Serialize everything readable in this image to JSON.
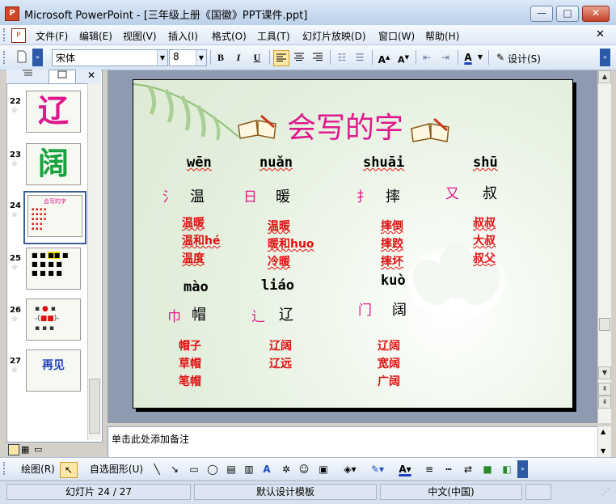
{
  "window": {
    "title": "Microsoft PowerPoint - [三年级上册《国徽》PPT课件.ppt]",
    "minimize_label": "—",
    "maximize_label": "□",
    "close_label": "✕",
    "doc_close_label": "✕"
  },
  "menu": {
    "items": [
      "文件(F)",
      "编辑(E)",
      "视图(V)",
      "插入(I)",
      "格式(O)",
      "工具(T)",
      "幻灯片放映(D)",
      "窗口(W)",
      "帮助(H)"
    ]
  },
  "toolbar": {
    "font_name": "宋体",
    "font_size": "8",
    "bold": "B",
    "italic": "I",
    "underline": "U",
    "design_label": "设计(S)"
  },
  "slide_pane": {
    "tabs": [
      "outline",
      "slides"
    ],
    "thumbnails": [
      {
        "num": "22",
        "text": "辽"
      },
      {
        "num": "23",
        "text": "阔"
      },
      {
        "num": "24",
        "text": "会写的字"
      },
      {
        "num": "25",
        "text": ""
      },
      {
        "num": "26",
        "text": ""
      },
      {
        "num": "27",
        "text": "再见"
      }
    ]
  },
  "slide": {
    "title": "会写的字",
    "row1": {
      "pinyin": [
        "wēn",
        "nuǎn",
        "shuāi",
        "shū"
      ],
      "radicals": [
        "氵",
        "日",
        "扌",
        "又"
      ],
      "chars": [
        "温",
        "暖",
        "摔",
        "叔"
      ],
      "words": [
        [
          "温暖",
          "温和hé",
          "温度"
        ],
        [
          "温暖",
          "暖和huo",
          "冷暖"
        ],
        [
          "摔倒",
          "摔跤",
          "摔坏"
        ],
        [
          "叔叔",
          "大叔",
          "叔父"
        ]
      ]
    },
    "row2": {
      "pinyin": [
        "mào",
        "liáo",
        "kuò"
      ],
      "radicals": [
        "巾",
        "辶",
        "门"
      ],
      "chars": [
        "帽",
        "辽",
        "阔"
      ],
      "words": [
        [
          "帽子",
          "草帽",
          "笔帽"
        ],
        [
          "辽阔",
          "辽远"
        ],
        [
          "辽阔",
          "宽阔",
          "广阔"
        ]
      ]
    }
  },
  "notes": {
    "placeholder": "单击此处添加备注"
  },
  "drawing": {
    "draw_label": "绘图(R)",
    "autoshape_label": "自选图形(U)"
  },
  "status": {
    "slide_info": "幻灯片 24 / 27",
    "template": "默认设计模板",
    "language": "中文(中国)"
  },
  "colors": {
    "title_pink": "#e0188e",
    "word_red": "#e01010",
    "radical_magenta": "#e0188e"
  }
}
